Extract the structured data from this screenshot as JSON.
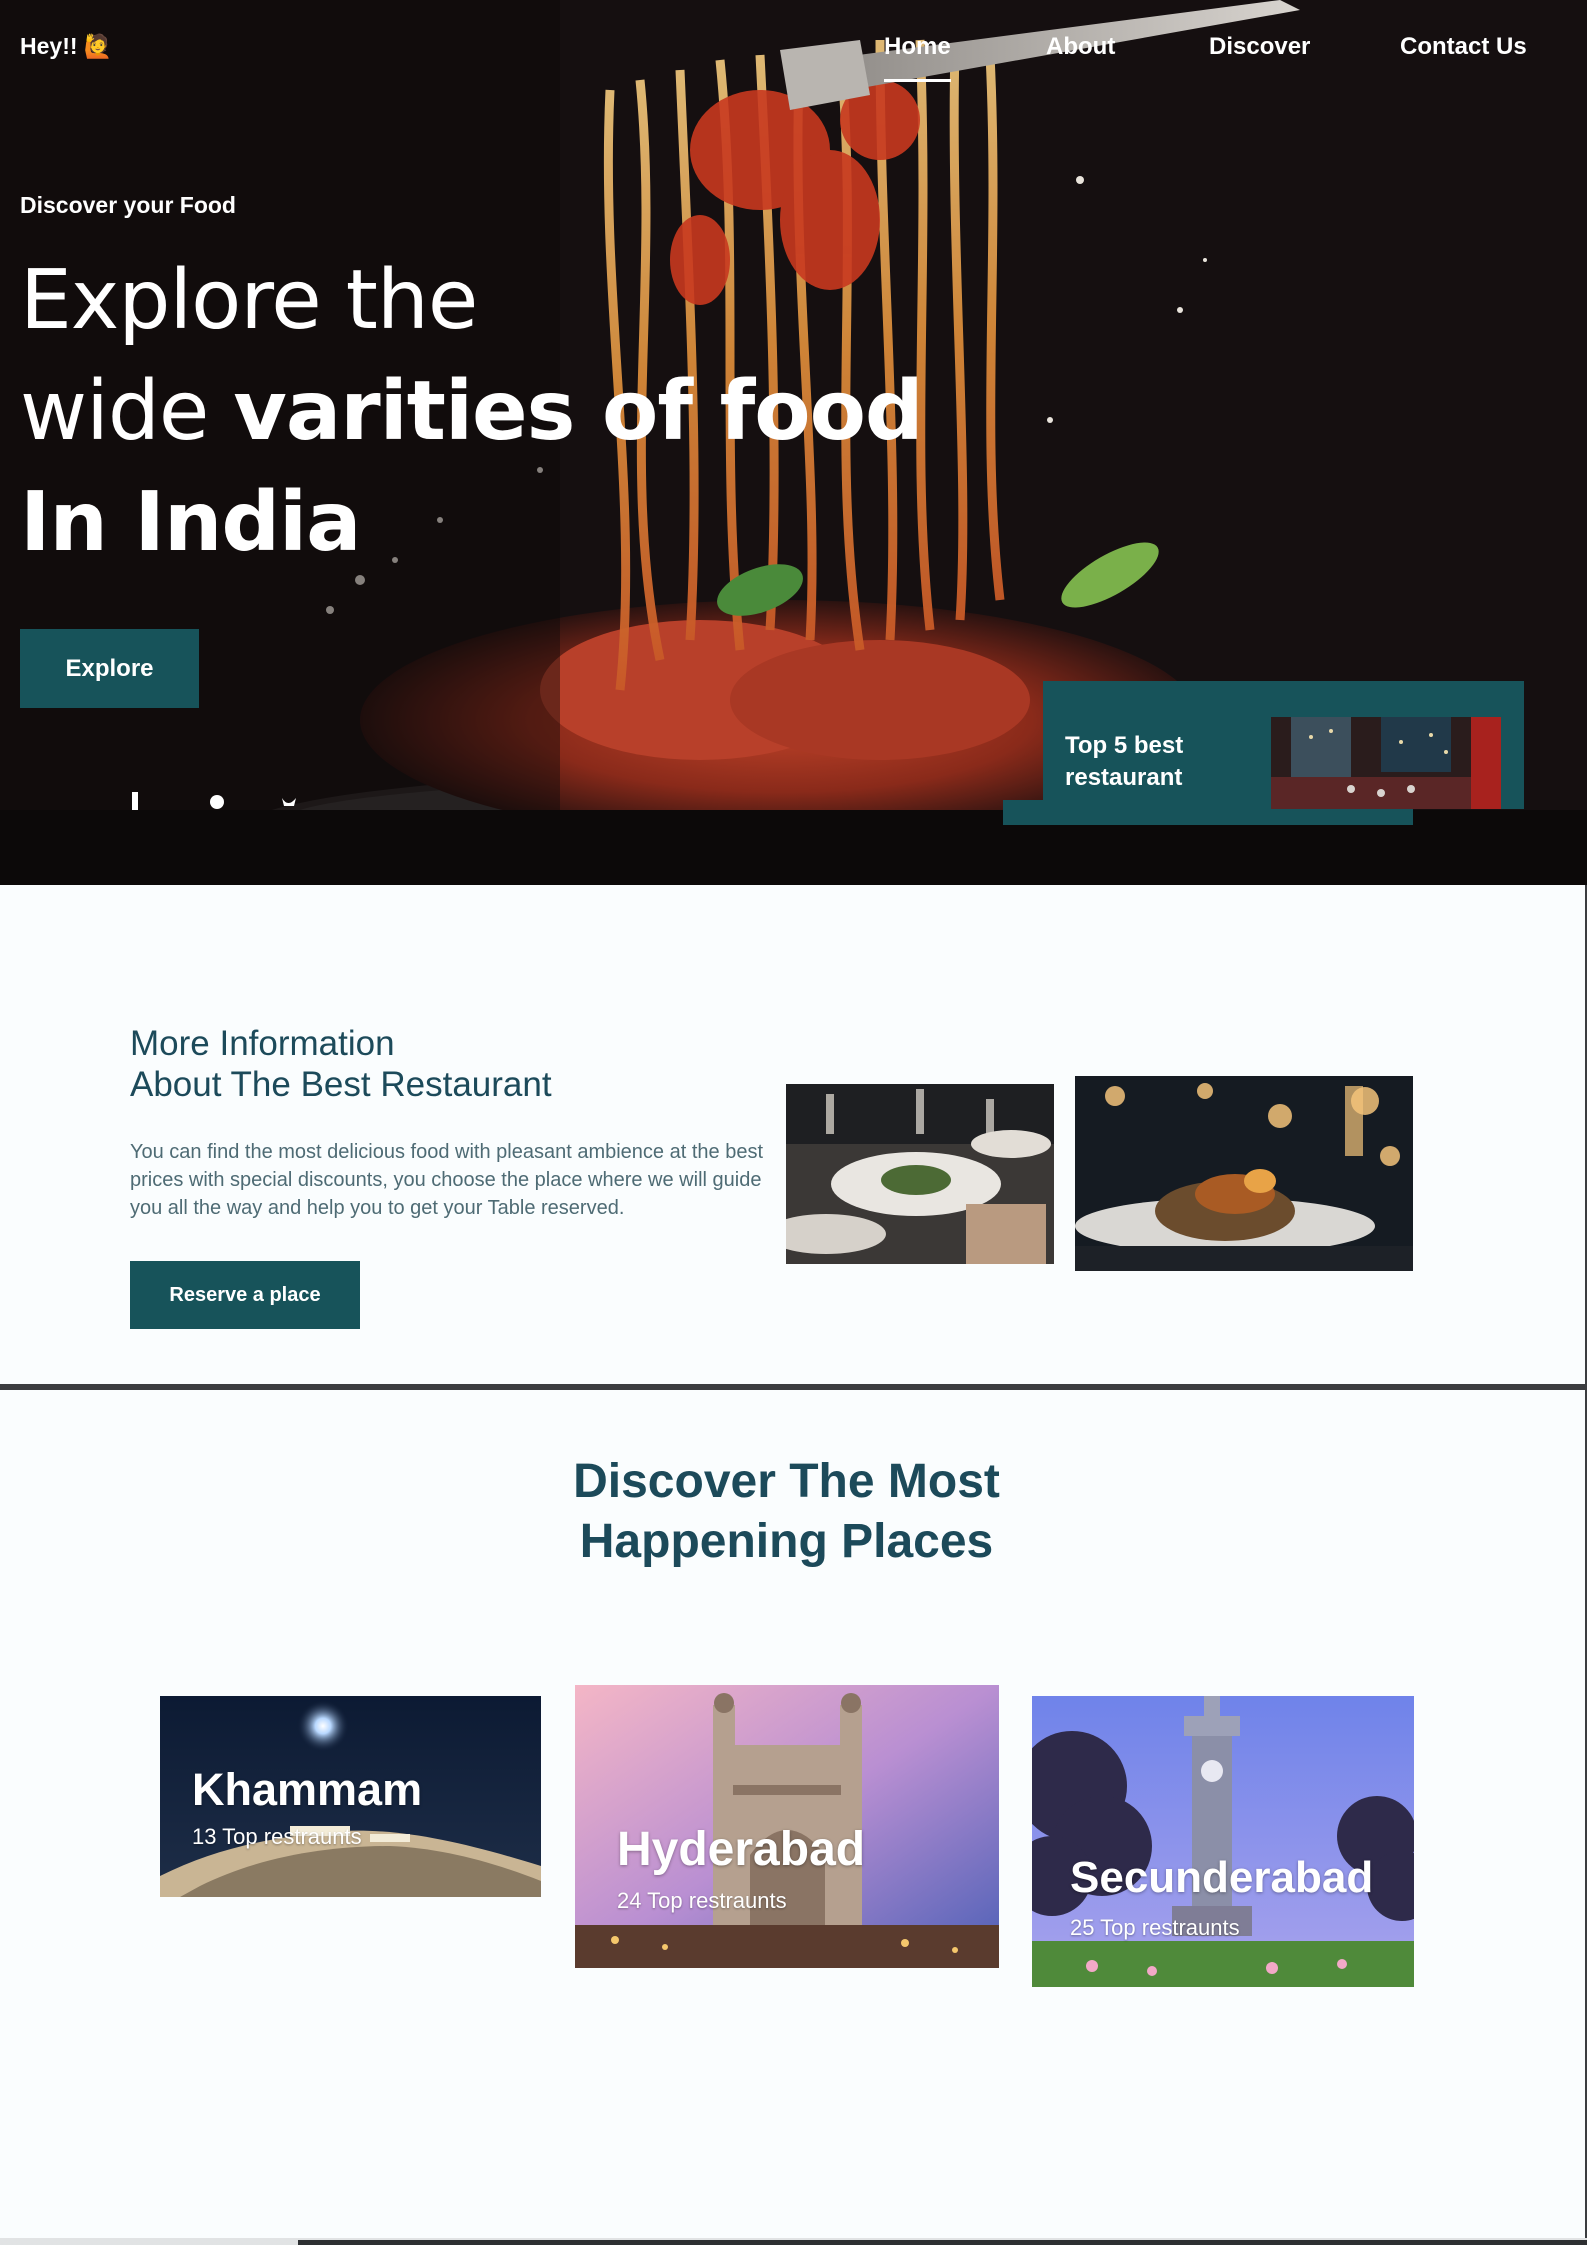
{
  "header": {
    "brand": "Hey!! 🙋",
    "nav": [
      "Home",
      "About",
      "Discover",
      "Contact Us"
    ],
    "active_nav": "Home"
  },
  "hero": {
    "kicker": "Discover your Food",
    "title_line1": "Explore the",
    "title_line2_light": "wide ",
    "title_line2_bold": "varities of food",
    "title_line3": "In India",
    "explore_label": "Explore",
    "top5_label": "Top 5 best restaurant"
  },
  "info": {
    "title_line1": "More Information",
    "title_line2": "About The Best Restaurant",
    "text": "You can find the most delicious food with pleasant ambience at the best prices with special discounts, you choose the place where we will guide you all the way and help you to get your Table reserved.",
    "reserve_label": "Reserve a place"
  },
  "discover": {
    "title_line1": "Discover The Most",
    "title_line2": "Happening Places",
    "places": [
      {
        "name": "Khammam",
        "count": "13 Top restraunts"
      },
      {
        "name": "Hyderabad",
        "count": "24 Top restraunts"
      },
      {
        "name": "Secunderabad",
        "count": "25 Top restraunts"
      }
    ]
  },
  "colors": {
    "accent": "#17535a",
    "heading": "#1c4a5a",
    "hero_bg": "#150f10",
    "page_bg": "#fafdfe"
  },
  "icons": [
    "facebook-icon",
    "instagram-icon",
    "twitter-icon"
  ]
}
